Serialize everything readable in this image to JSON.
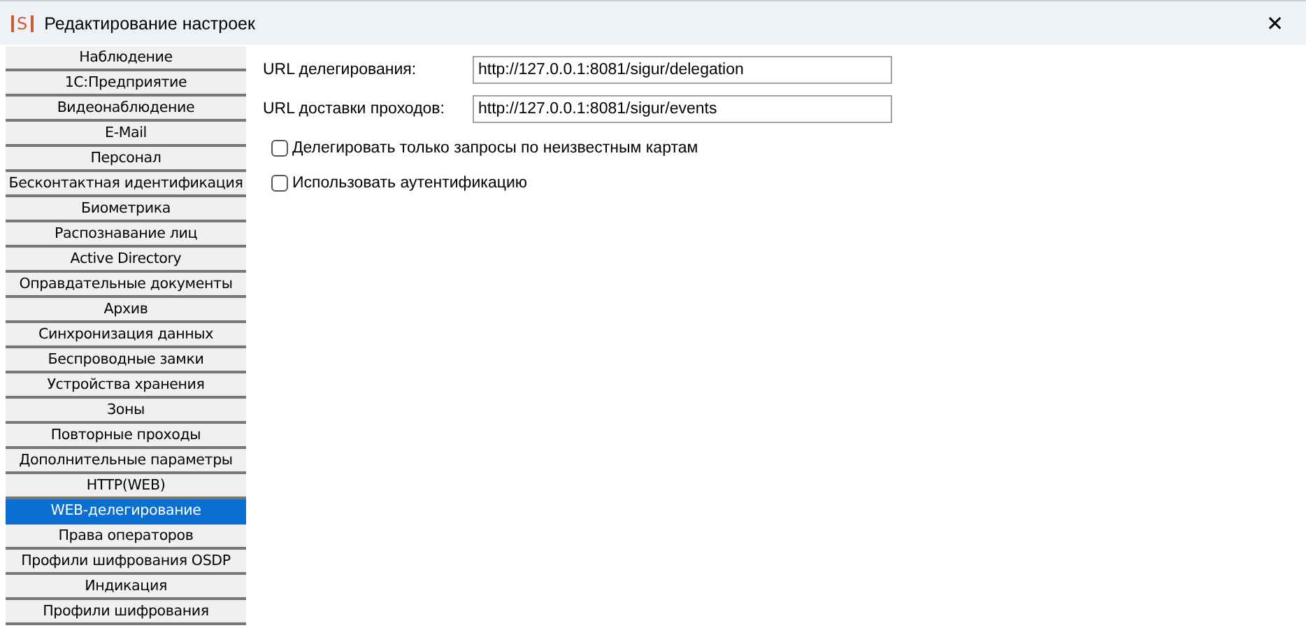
{
  "window": {
    "app_icon": "S",
    "title": "Редактирование настроек",
    "close": "✕"
  },
  "sidebar": {
    "items": [
      {
        "label": "Наблюдение",
        "selected": false
      },
      {
        "label": "1С:Предприятие",
        "selected": false
      },
      {
        "label": "Видеонаблюдение",
        "selected": false
      },
      {
        "label": "E-Mail",
        "selected": false
      },
      {
        "label": "Персонал",
        "selected": false
      },
      {
        "label": "Бесконтактная идентификация",
        "selected": false
      },
      {
        "label": "Биометрика",
        "selected": false
      },
      {
        "label": "Распознавание лиц",
        "selected": false
      },
      {
        "label": "Active Directory",
        "selected": false
      },
      {
        "label": "Оправдательные документы",
        "selected": false
      },
      {
        "label": "Архив",
        "selected": false
      },
      {
        "label": "Синхронизация данных",
        "selected": false
      },
      {
        "label": "Беспроводные замки",
        "selected": false
      },
      {
        "label": "Устройства хранения",
        "selected": false
      },
      {
        "label": "Зоны",
        "selected": false
      },
      {
        "label": "Повторные проходы",
        "selected": false
      },
      {
        "label": "Дополнительные параметры",
        "selected": false
      },
      {
        "label": "HTTP(WEB)",
        "selected": false
      },
      {
        "label": "WEB-делегирование",
        "selected": true
      },
      {
        "label": "Права операторов",
        "selected": false
      },
      {
        "label": "Профили шифрования OSDP",
        "selected": false
      },
      {
        "label": "Индикация",
        "selected": false
      },
      {
        "label": "Профили шифрования",
        "selected": false
      }
    ]
  },
  "fields": [
    {
      "label": "URL делегирования:",
      "value": "http://127.0.0.1:8081/sigur/delegation"
    },
    {
      "label": "URL доставки проходов:",
      "value": "http://127.0.0.1:8081/sigur/events"
    }
  ],
  "checkboxes": [
    {
      "label": "Делегировать только запросы по неизвестным картам",
      "checked": false
    },
    {
      "label": "Использовать аутентификацию",
      "checked": false
    }
  ]
}
